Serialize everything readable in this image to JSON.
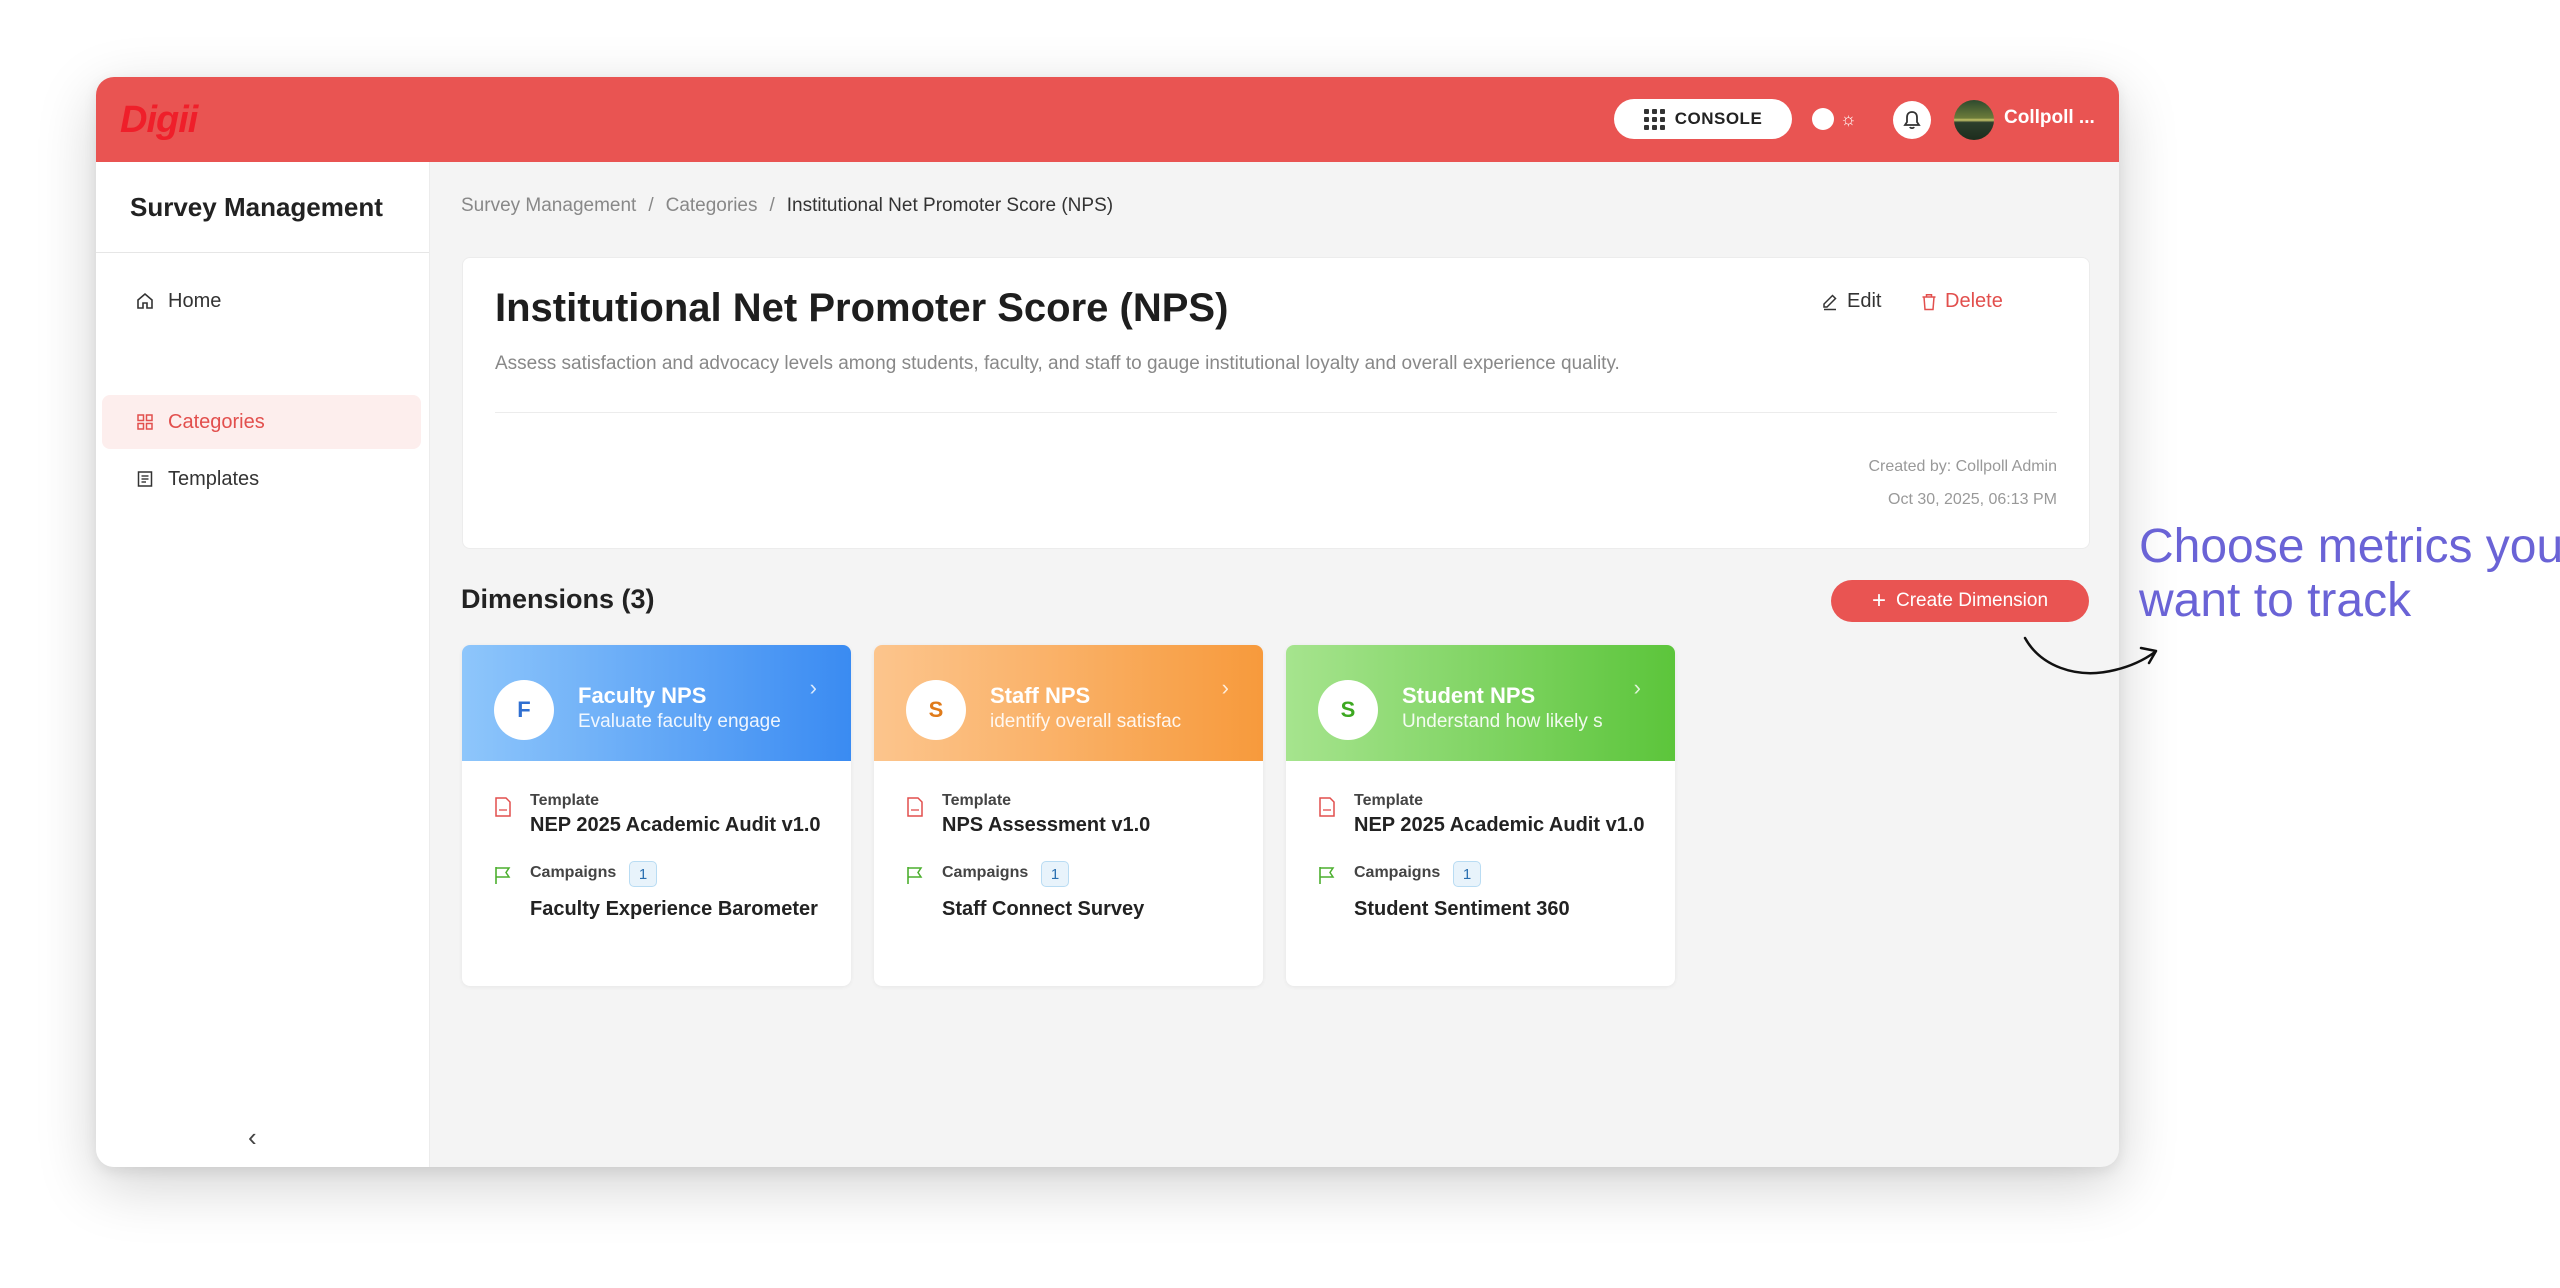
{
  "header": {
    "logo": "Digii",
    "console_label": "CONSOLE",
    "user_name": "Collpoll ...",
    "colors": {
      "brand": "#e95452"
    }
  },
  "sidebar": {
    "title": "Survey Management",
    "items": [
      {
        "label": "Home",
        "icon": "home-icon",
        "active": false
      },
      {
        "label": "Categories",
        "icon": "grid-icon",
        "active": true
      },
      {
        "label": "Templates",
        "icon": "template-icon",
        "active": false
      }
    ],
    "collapse_glyph": "‹"
  },
  "breadcrumb": {
    "items": [
      "Survey Management",
      "Categories",
      "Institutional Net Promoter Score (NPS)"
    ],
    "separator": "/"
  },
  "category": {
    "title": "Institutional Net Promoter Score (NPS)",
    "description": "Assess satisfaction and advocacy levels among students, faculty, and staff to gauge institutional loyalty and overall experience quality.",
    "edit_label": "Edit",
    "delete_label": "Delete",
    "created_by": "Created by: Collpoll Admin",
    "created_at": "Oct 30, 2025, 06:13 PM"
  },
  "dimensions": {
    "title": "Dimensions (3)",
    "create_label": "Create Dimension",
    "template_label": "Template",
    "campaigns_label": "Campaigns",
    "cards": [
      {
        "initial": "F",
        "name": "Faculty NPS",
        "subtitle": "Evaluate faculty engage",
        "template": "NEP 2025 Academic Audit v1.0",
        "campaign_count": "1",
        "campaign": "Faculty Experience Barometer",
        "color": "#3a8bf2",
        "initial_color": "#2f6fd1"
      },
      {
        "initial": "S",
        "name": "Staff NPS",
        "subtitle": "identify overall satisfac",
        "template": "NPS Assessment v1.0",
        "campaign_count": "1",
        "campaign": "Staff Connect Survey",
        "color": "#f79a3c",
        "initial_color": "#e07b1a"
      },
      {
        "initial": "S",
        "name": "Student NPS",
        "subtitle": "Understand how likely s",
        "template": "NEP 2025 Academic Audit v1.0",
        "campaign_count": "1",
        "campaign": "Student Sentiment 360",
        "color": "#5cc53b",
        "initial_color": "#3da821"
      }
    ]
  },
  "annotation": {
    "line1": "Choose metrics you",
    "line2": "want to track",
    "color": "#6a63d6"
  }
}
